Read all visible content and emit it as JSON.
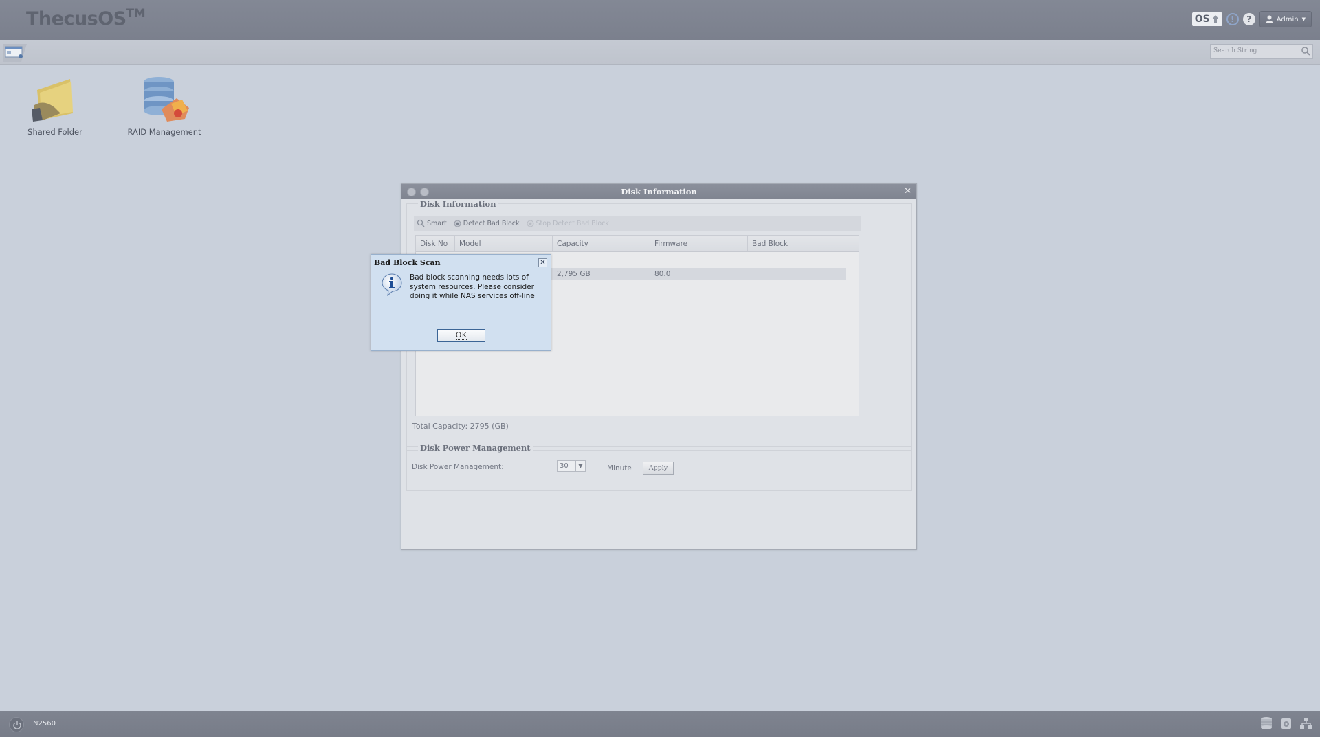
{
  "header": {
    "brand": "ThecusOS",
    "brand_tm": "TM",
    "os_badge": "OS",
    "user": "Admin"
  },
  "toolbar": {
    "search_placeholder": "Search String"
  },
  "desktop": {
    "icons": [
      {
        "label": "Shared Folder",
        "icon": "shared-folder-icon"
      },
      {
        "label": "RAID Management",
        "icon": "raid-management-icon"
      }
    ]
  },
  "window": {
    "title": "Disk Information",
    "disk_section_title": "Disk Information",
    "toolbar": {
      "smart": "Smart",
      "detect_bad_block": "Detect Bad Block",
      "stop_detect_bad_block": "Stop Detect Bad Block"
    },
    "columns": [
      "Disk No",
      "Model",
      "Capacity",
      "Firmware",
      "Bad Block"
    ],
    "rows": [
      {
        "capacity": "2,795 GB",
        "firmware": "80.0"
      }
    ],
    "total_capacity": "Total Capacity: 2795 (GB)",
    "power_section_title": "Disk Power Management",
    "power_label": "Disk Power Management:",
    "power_value": "30",
    "power_unit": "Minute",
    "apply_label": "Apply"
  },
  "dialog": {
    "title": "Bad Block Scan",
    "message": "Bad block scanning needs lots of system resources. Please consider doing it while NAS services off-line",
    "ok_label": "OK"
  },
  "taskbar": {
    "hostname": "N2560"
  },
  "colors": {
    "desktop_bg": "#c9d0db",
    "header_bg": "#7f8490",
    "dialog_bg": "#d1e0f0",
    "dialog_border": "#98b0cc"
  }
}
